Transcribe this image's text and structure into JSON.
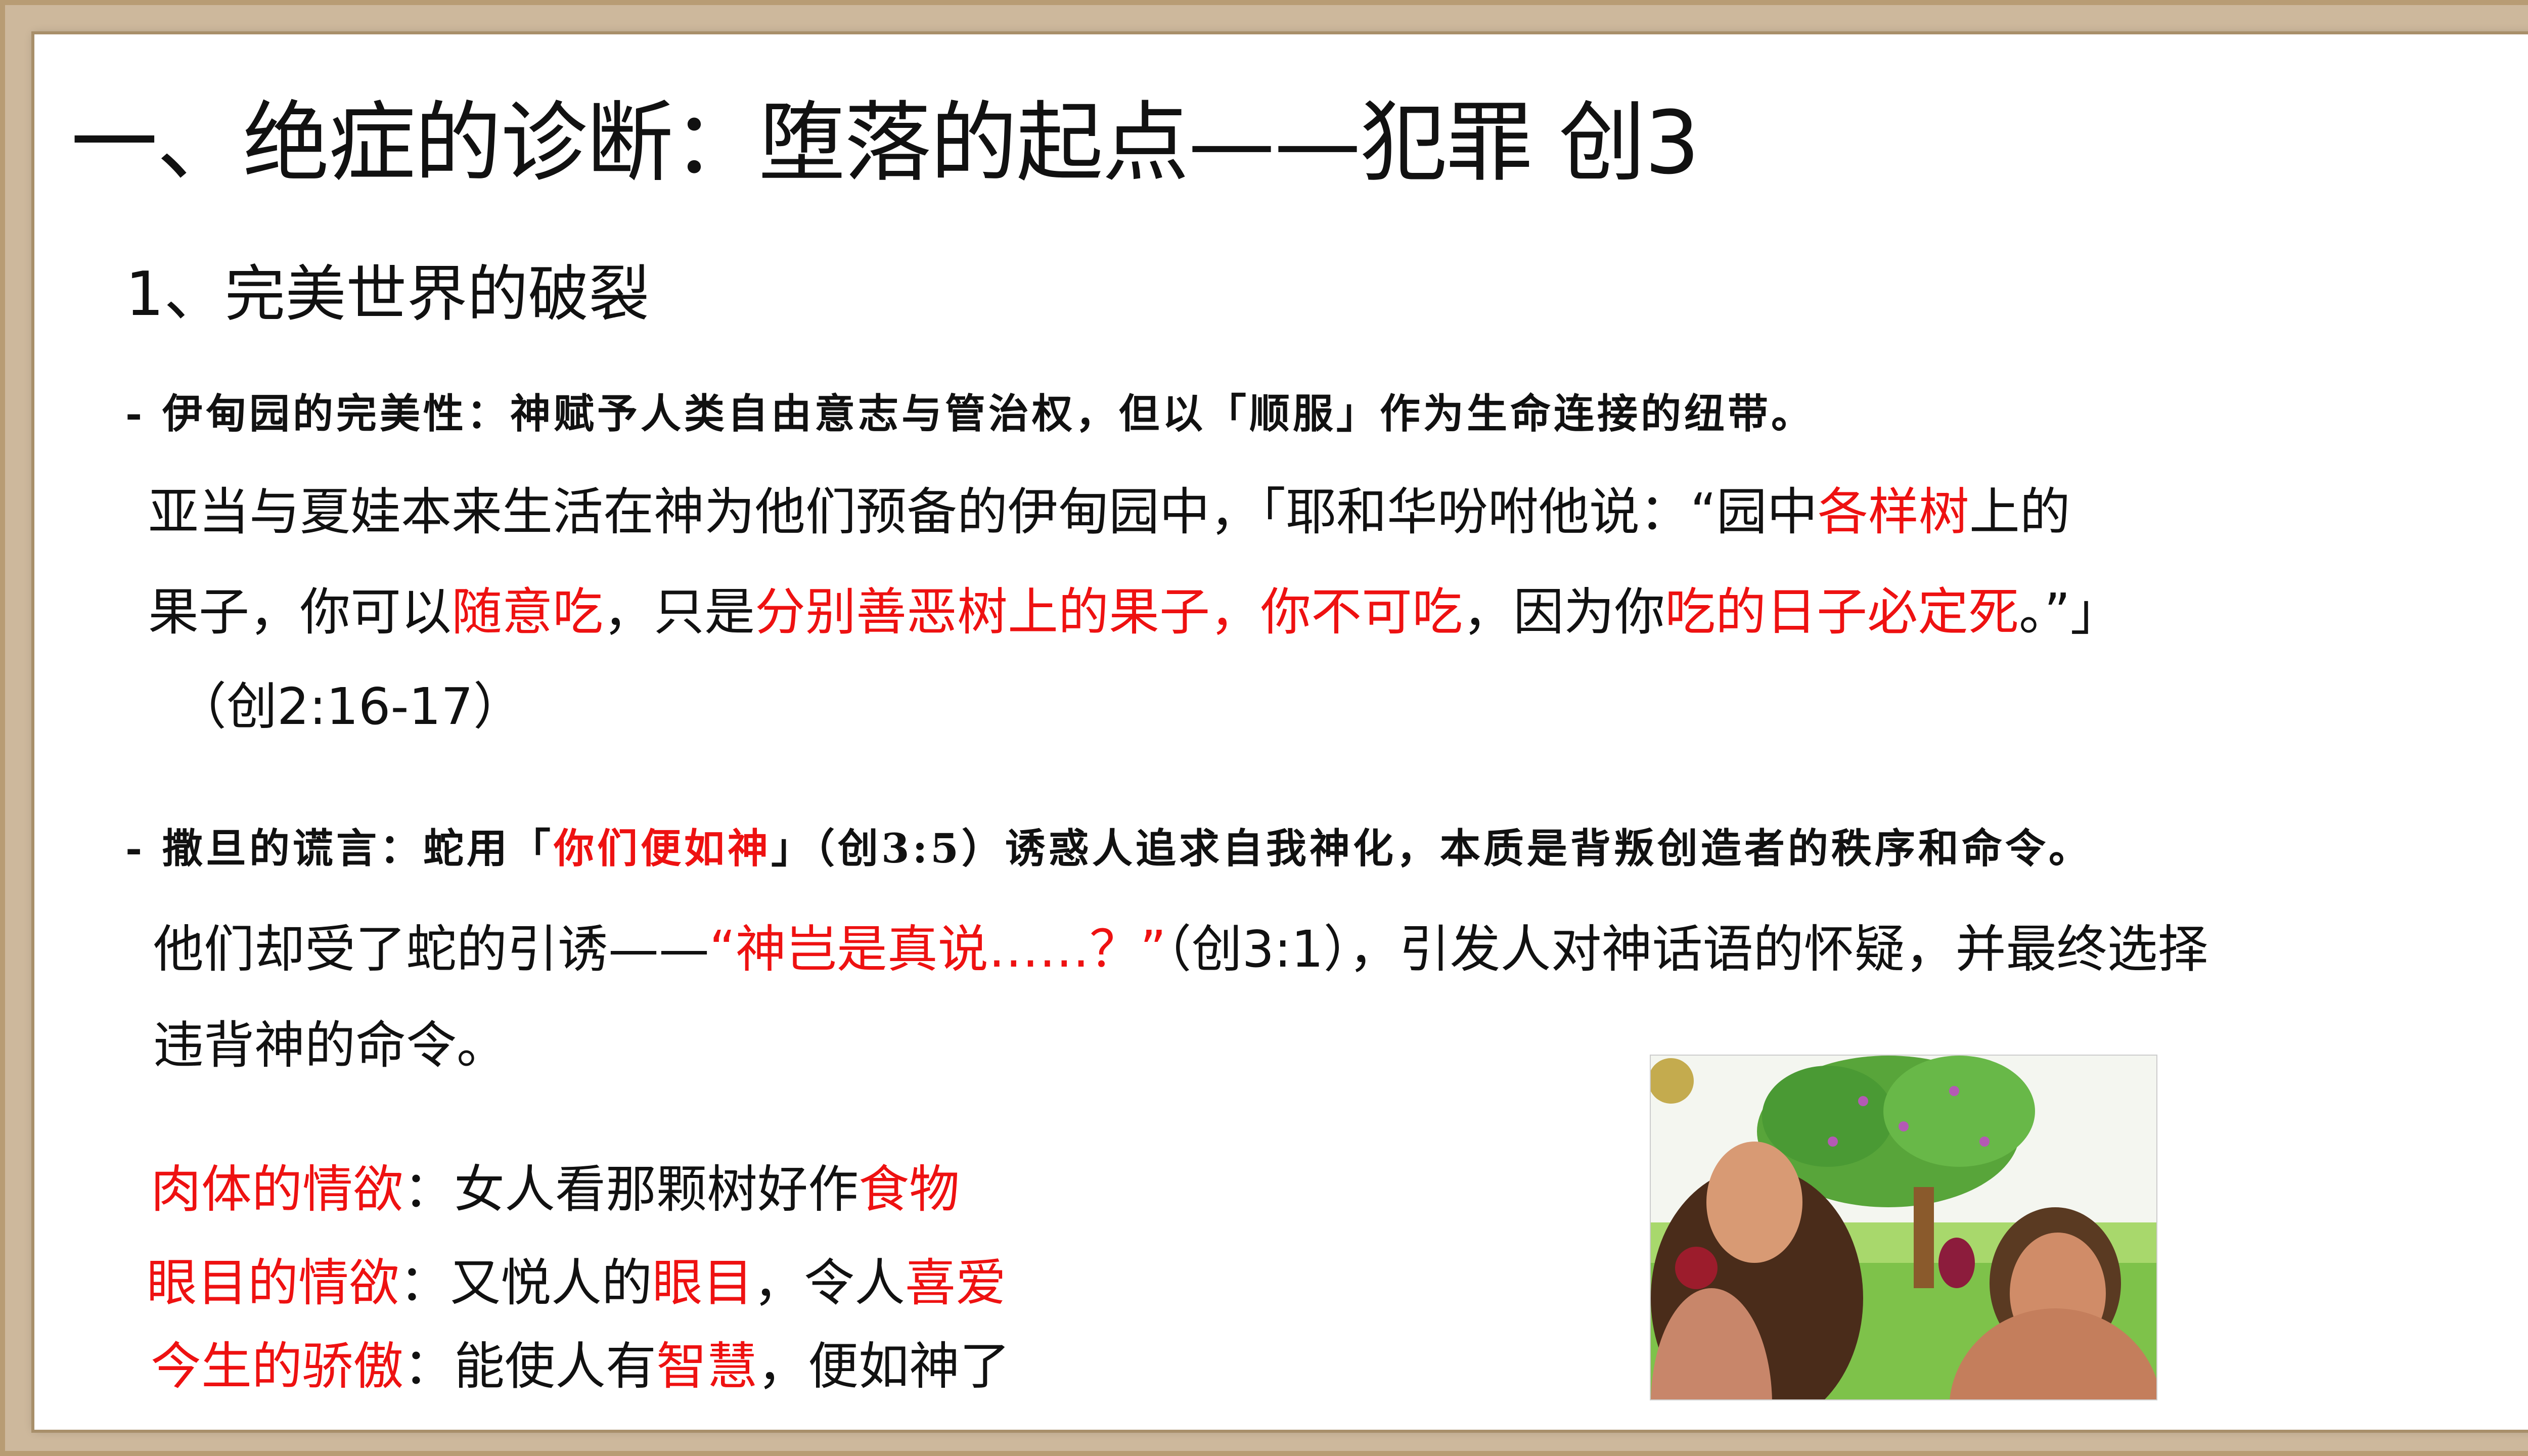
{
  "title": "一、绝症的诊断：堕落的起点——犯罪 创3",
  "subtitle": "1、完美世界的破裂",
  "bullet1": "- 伊甸园的完美性：神赋予人类自由意志与管治权，但以「顺服」作为生命连接的纽带。",
  "para1": {
    "line1_a": "亚当与夏娃本来生活在神为他们预备的伊甸园中，「耶和华吩咐他说：“园中",
    "line1_b": "各样树",
    "line1_c": "上的",
    "line2_a": "果子，你可以",
    "line2_b": "随意吃",
    "line2_c": "，只是",
    "line2_d": "分别善恶树上的果子，你不可吃",
    "line2_e": "，因为你",
    "line2_f": "吃的日子必定死",
    "line2_g": "。”」",
    "line3": "（创2:16-17）"
  },
  "bullet2": {
    "a": "- 撒旦的谎言：蛇用「",
    "b": "你们便如神",
    "c": "」（创3:5）诱惑人追求自我神化，本质是背叛创造者的秩序和命令。"
  },
  "para2": {
    "line1_a": "他们却受了蛇的引诱——",
    "line1_b": "“神岂是真说……？”",
    "line1_c": "（创3:1），引发人对神话语的怀疑，并最终选择",
    "line2": "违背神的命令。"
  },
  "lusts": [
    {
      "label": "肉体的情欲",
      "text_a": "：女人看那颗树好作",
      "text_b": "食物",
      "text_c": "",
      "text_d": "",
      "text_e": ""
    },
    {
      "label": "眼目的情欲",
      "text_a": "：又悦人的",
      "text_b": "眼目",
      "text_c": "，令人",
      "text_d": "喜爱",
      "text_e": ""
    },
    {
      "label": "今生的骄傲",
      "text_a": "：能使人有",
      "text_b": "智慧",
      "text_c": "，便如神了",
      "text_d": "",
      "text_e": ""
    }
  ],
  "colors": {
    "accent_red": "#ee1111",
    "frame": "#b89c74"
  }
}
